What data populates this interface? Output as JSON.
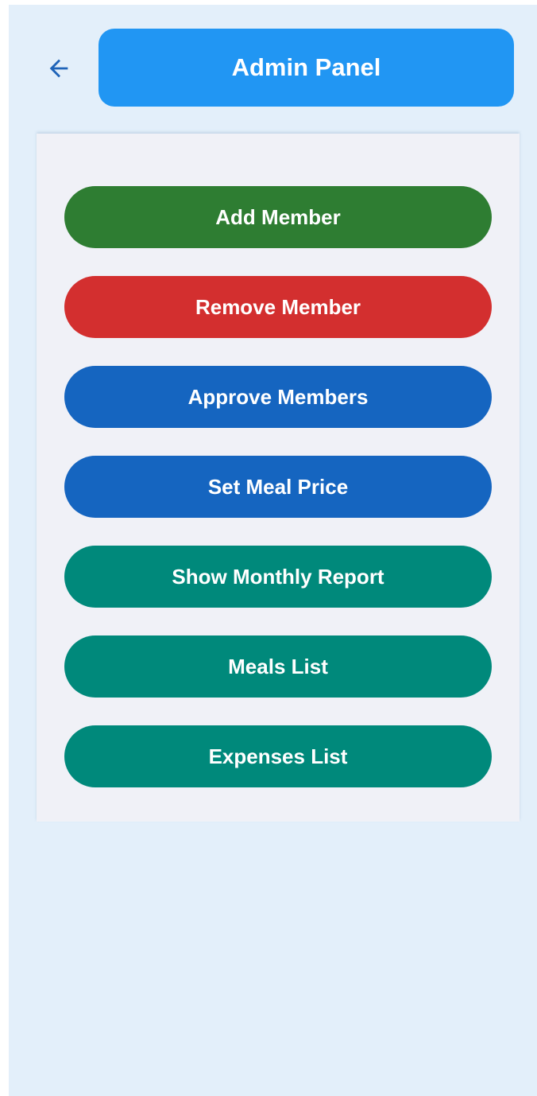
{
  "header": {
    "title": "Admin Panel",
    "back_icon": "arrow-left-icon",
    "title_color": "#2196f3"
  },
  "menu": {
    "buttons": [
      {
        "id": "add-member-button",
        "label": "Add Member",
        "color": "#2e7d32"
      },
      {
        "id": "remove-member-button",
        "label": "Remove Member",
        "color": "#d32f2f"
      },
      {
        "id": "approve-members-button",
        "label": "Approve Members",
        "color": "#1565c0"
      },
      {
        "id": "set-meal-price-button",
        "label": "Set Meal Price",
        "color": "#1565c0"
      },
      {
        "id": "show-monthly-report-button",
        "label": "Show Monthly Report",
        "color": "#00897b"
      },
      {
        "id": "meals-list-button",
        "label": "Meals List",
        "color": "#00897b"
      },
      {
        "id": "expenses-list-button",
        "label": "Expenses List",
        "color": "#00897b"
      }
    ]
  },
  "colors": {
    "background": "#e3effa",
    "panel": "#f0f1f7",
    "back_arrow": "#1e63b8"
  }
}
